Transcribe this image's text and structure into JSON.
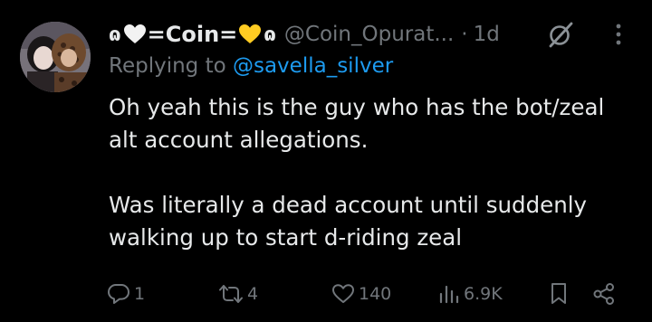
{
  "tweet": {
    "display_name_part1": "=Coin=",
    "display_name_prefix_glyph": "ɷ",
    "display_name_suffix_glyph": "ɷ",
    "handle": "@Coin_Opurat...",
    "separator": "·",
    "time": "1d",
    "replying_label": "Replying to ",
    "replying_mention": "@savella_silver",
    "body_paragraph_1": "Oh yeah this is the guy who has the bot/zeal\nalt account allegations.",
    "body_paragraph_2": "Was literally a dead account until suddenly\nwalking up to start d-riding zeal",
    "replies": "1",
    "reposts": "4",
    "likes": "140",
    "views": "6.9K"
  },
  "icons": {
    "heart_white": "white-heart-icon",
    "heart_yellow": "yellow-heart-icon",
    "grok": "grok-icon",
    "more": "more-icon",
    "reply": "reply-icon",
    "repost": "repost-icon",
    "like": "like-icon",
    "views": "views-icon",
    "bookmark": "bookmark-icon",
    "share": "share-icon"
  },
  "colors": {
    "background": "#000000",
    "text": "#e7e9ea",
    "secondary": "#71767b",
    "link": "#1d9bf0",
    "heart_yellow": "#ffcc22"
  }
}
